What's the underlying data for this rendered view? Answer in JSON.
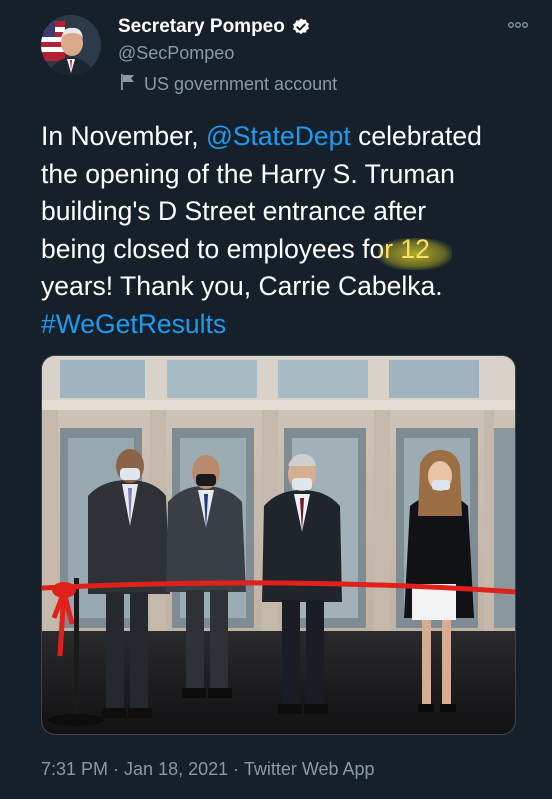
{
  "author": {
    "display_name": "Secretary Pompeo",
    "handle": "@SecPompeo",
    "label": "US government account"
  },
  "icons": {
    "verified": "verified-badge-icon",
    "flag": "flag-icon",
    "more": "more-icon"
  },
  "tweet": {
    "part1": "In November, ",
    "mention": "@StateDept",
    "part2": " celebrated\nthe opening of the Harry S. Truman\nbuilding's D Street entrance after\nbeing closed to employees fo",
    "highlighted": "r 12",
    "part3": "\nyears! Thank you, Carrie Cabelka.\n",
    "hashtag": "#WeGetResults"
  },
  "footer": {
    "time": "7:31 PM",
    "separator1": " · ",
    "date": "Jan 18, 2021",
    "separator2": " · ",
    "source": "Twitter Web App"
  },
  "colors": {
    "background": "#15202b",
    "link": "#1d9bf0",
    "secondary_text": "#8b98a5",
    "ribbon": "#e0201b",
    "highlight": "#e6dc28"
  }
}
